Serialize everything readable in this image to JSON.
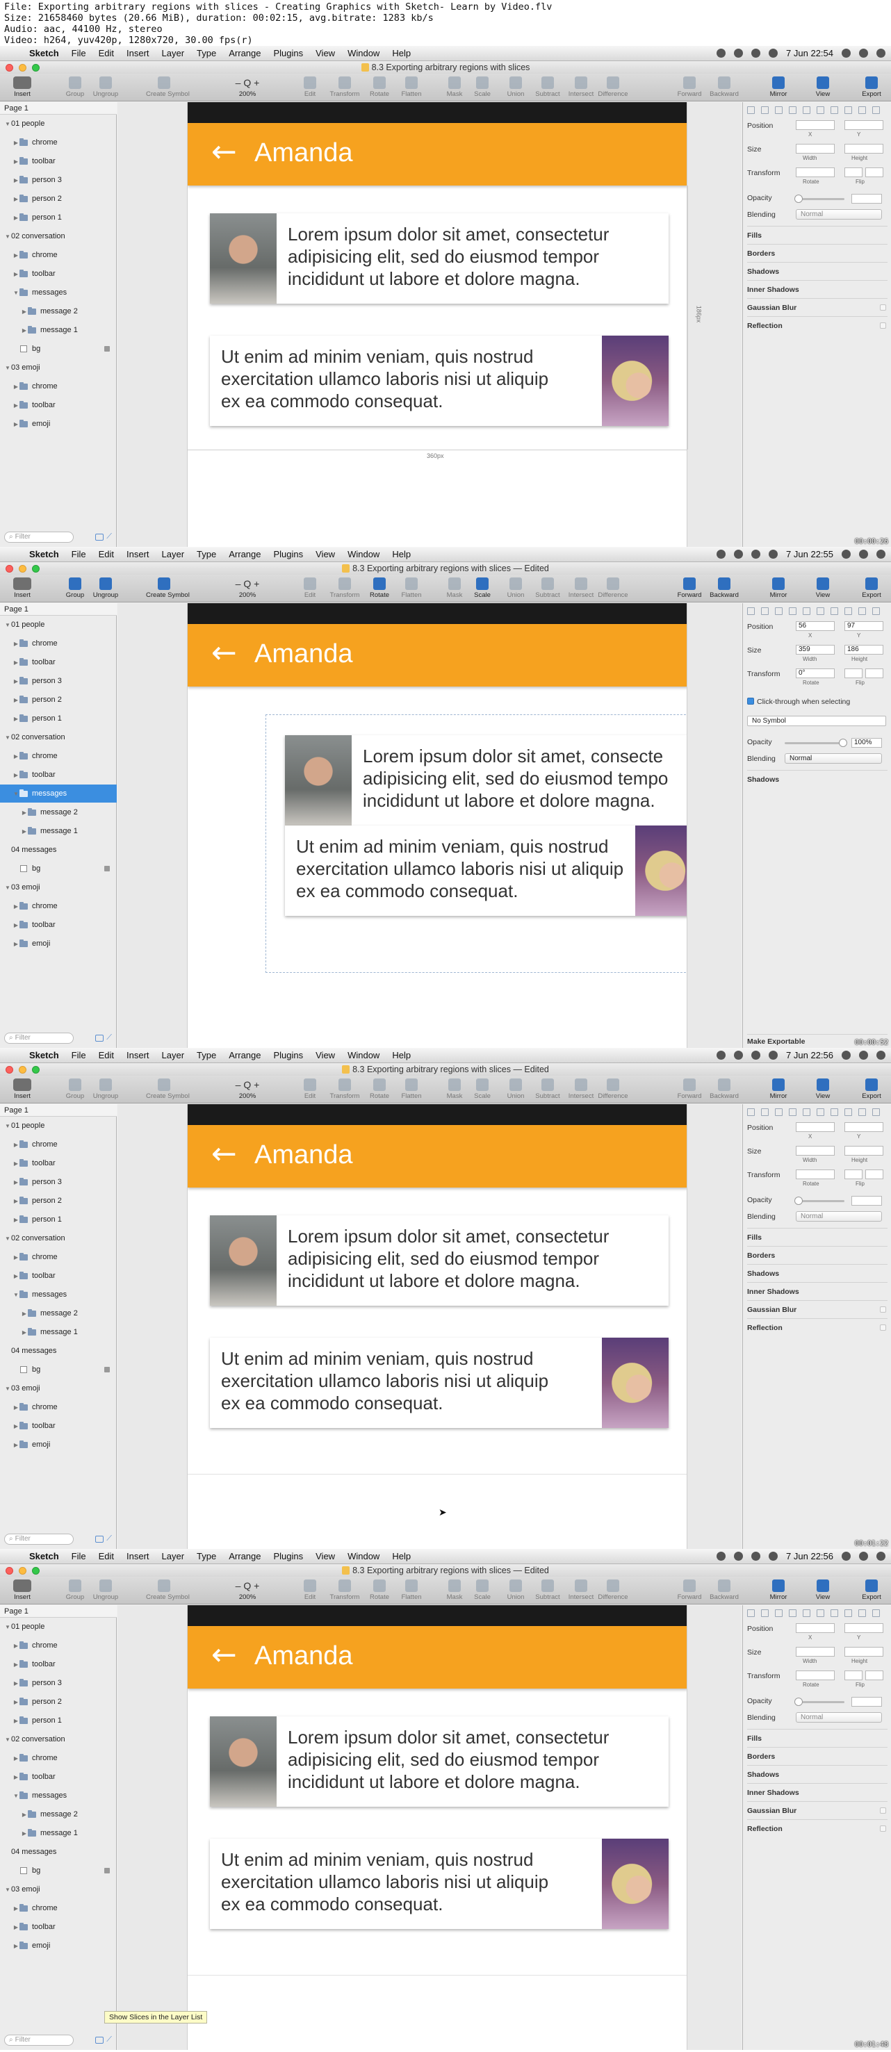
{
  "video_info": {
    "line1": "File: Exporting arbitrary regions with slices - Creating Graphics with Sketch- Learn by Video.flv",
    "line2": "Size: 21658460 bytes (20.66 MiB), duration: 00:02:15, avg.bitrate: 1283 kb/s",
    "line3": "Audio: aac, 44100 Hz, stereo",
    "line4": "Video: h264, yuv420p, 1280x720, 30.00 fps(r)"
  },
  "menubar": {
    "apple": "",
    "items": [
      "Sketch",
      "File",
      "Edit",
      "Insert",
      "Layer",
      "Type",
      "Arrange",
      "Plugins",
      "View",
      "Window",
      "Help"
    ]
  },
  "toolbar": {
    "tools": [
      "Insert",
      "Group",
      "Ungroup",
      "Create Symbol",
      "200%",
      "Edit",
      "Transform",
      "Rotate",
      "Flatten",
      "Mask",
      "Scale",
      "Union",
      "Subtract",
      "Intersect",
      "Difference",
      "Forward",
      "Backward",
      "Mirror",
      "View",
      "Export"
    ],
    "zoom_glyph": "– Q +"
  },
  "layers": {
    "page": "Page 1",
    "filter_placeholder": "Filter",
    "rows_default": [
      "01 people",
      "chrome",
      "toolbar",
      "person 3",
      "person 2",
      "person 1",
      "02 conversation",
      "chrome",
      "toolbar",
      "messages",
      "message 2",
      "message 1",
      "bg",
      "03 emoji",
      "chrome",
      "toolbar",
      "emoji"
    ],
    "rows_with_slice": [
      "01 people",
      "chrome",
      "toolbar",
      "person 3",
      "person 2",
      "person 1",
      "02 conversation",
      "chrome",
      "toolbar",
      "messages",
      "message 2",
      "message 1",
      "04 messages",
      "bg",
      "03 emoji",
      "chrome",
      "toolbar",
      "emoji"
    ]
  },
  "conversation": {
    "contact": "Amanda",
    "message_1_lines": [
      "Lorem ipsum dolor sit amet, consectetur",
      "adipisicing elit, sed do eiusmod tempor",
      "incididunt ut labore et dolore magna."
    ],
    "message_2_lines": [
      "Ut enim ad minim veniam, quis nostrud",
      "exercitation ullamco laboris nisi ut aliquip",
      "ex ea commodo consequat."
    ],
    "message_1_lines_cut": [
      "Lorem ipsum dolor sit amet, consecte",
      "adipisicing elit, sed do eiusmod tempo",
      "incididunt ut labore et dolore magna."
    ]
  },
  "measurements": {
    "width_label": "360px",
    "height_label": "186px"
  },
  "inspector": {
    "position": "Position",
    "size": "Size",
    "transform": "Transform",
    "opacity": "Opacity",
    "blending": "Blending",
    "x": "X",
    "y": "Y",
    "width": "Width",
    "height": "Height",
    "rotate": "Rotate",
    "flip": "Flip",
    "blend_mode": "Normal",
    "sections": [
      "Fills",
      "Borders",
      "Shadows",
      "Inner Shadows",
      "Gaussian Blur",
      "Reflection"
    ],
    "slice": {
      "x": "56",
      "y": "97",
      "w": "359",
      "h": "186",
      "rotation": "0°",
      "click_through": "Click-through when selecting",
      "symbol": "No Symbol",
      "opacity_value": "100%",
      "shadows": "Shadows",
      "make_exportable": "Make Exportable"
    }
  },
  "frames": [
    {
      "clock": "7 Jun  22:54",
      "title": "8.3 Exporting arbitrary regions with slices",
      "timestamp": "00:00:26"
    },
    {
      "clock": "7 Jun  22:55",
      "title": "8.3 Exporting arbitrary regions with slices — Edited",
      "timestamp": "00:00:52"
    },
    {
      "clock": "7 Jun  22:56",
      "title": "8.3 Exporting arbitrary regions with slices — Edited",
      "timestamp": "00:01:22"
    },
    {
      "clock": "7 Jun  22:56",
      "title": "8.3 Exporting arbitrary regions with slices — Edited",
      "timestamp": "00:01:48"
    }
  ],
  "tooltip": "Show Slices in the Layer List",
  "icons": {
    "back": "←",
    "chevron_closed": "▶",
    "chevron_open": "▼",
    "slice": "⟋",
    "magnifier": "⌕",
    "cursor": "➤"
  },
  "colors": {
    "appbar": "#f6a21f",
    "selection": "#3b8ee0"
  }
}
